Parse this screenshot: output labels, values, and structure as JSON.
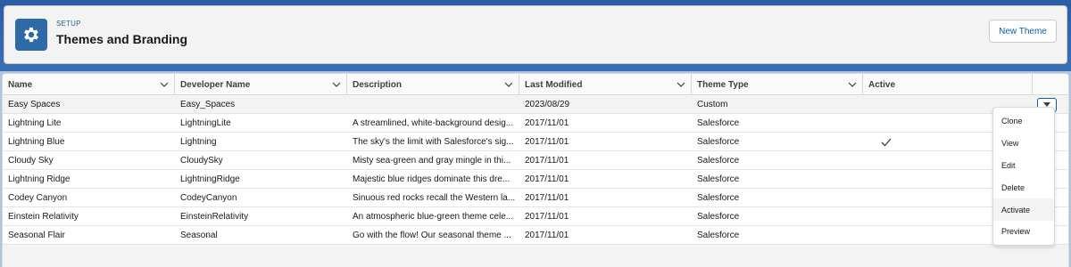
{
  "header": {
    "eyebrow": "SETUP",
    "title": "Themes and Branding",
    "new_button": "New Theme"
  },
  "columns": [
    "Name",
    "Developer Name",
    "Description",
    "Last Modified",
    "Theme Type",
    "Active"
  ],
  "rows": [
    {
      "name": "Easy Spaces",
      "dev": "Easy_Spaces",
      "desc": "",
      "modified": "2023/08/29",
      "type": "Custom",
      "active": false
    },
    {
      "name": "Lightning Lite",
      "dev": "LightningLite",
      "desc": "A streamlined, white-background desig...",
      "modified": "2017/11/01",
      "type": "Salesforce",
      "active": false
    },
    {
      "name": "Lightning Blue",
      "dev": "Lightning",
      "desc": "The sky's the limit with Salesforce's sig...",
      "modified": "2017/11/01",
      "type": "Salesforce",
      "active": true
    },
    {
      "name": "Cloudy Sky",
      "dev": "CloudySky",
      "desc": "Misty sea-green and gray mingle in thi...",
      "modified": "2017/11/01",
      "type": "Salesforce",
      "active": false
    },
    {
      "name": "Lightning Ridge",
      "dev": "LightningRidge",
      "desc": "Majestic blue ridges dominate this dre...",
      "modified": "2017/11/01",
      "type": "Salesforce",
      "active": false
    },
    {
      "name": "Codey Canyon",
      "dev": "CodeyCanyon",
      "desc": "Sinuous red rocks recall the Western la...",
      "modified": "2017/11/01",
      "type": "Salesforce",
      "active": false
    },
    {
      "name": "Einstein Relativity",
      "dev": "EinsteinRelativity",
      "desc": "An atmospheric blue-green theme cele...",
      "modified": "2017/11/01",
      "type": "Salesforce",
      "active": false
    },
    {
      "name": "Seasonal Flair",
      "dev": "Seasonal",
      "desc": "Go with the flow! Our seasonal theme ...",
      "modified": "2017/11/01",
      "type": "Salesforce",
      "active": false
    }
  ],
  "row_menu": {
    "items": [
      "Clone",
      "View",
      "Edit",
      "Delete",
      "Activate",
      "Preview"
    ],
    "highlighted": "Activate"
  },
  "colors": {
    "brand_blue": "#0b5cab",
    "icon_bg": "#2f6aa8"
  }
}
